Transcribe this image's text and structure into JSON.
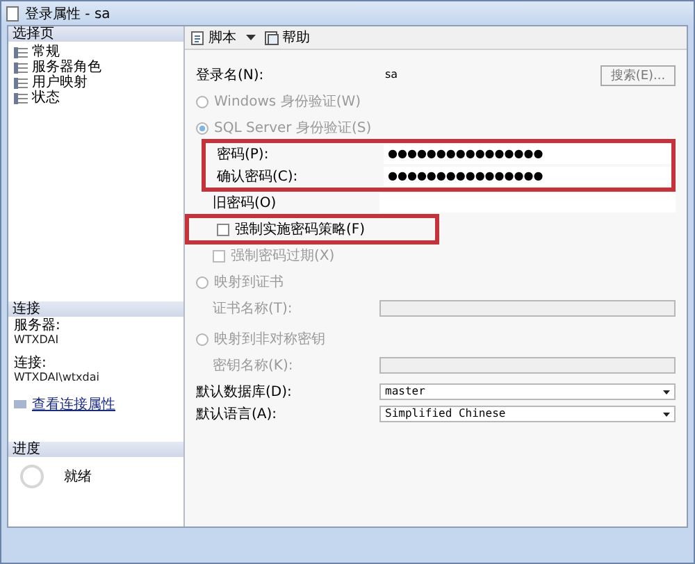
{
  "window": {
    "title": "登录属性 - sa"
  },
  "sidebar": {
    "heading": "选择页",
    "items": [
      {
        "label": "常规"
      },
      {
        "label": "服务器角色"
      },
      {
        "label": "用户映射"
      },
      {
        "label": "状态"
      }
    ]
  },
  "connection": {
    "heading": "连接",
    "server_label": "服务器:",
    "server": "WTXDAI",
    "connection_label": "连接:",
    "connection": "WTXDAI\\wtxdai",
    "link": "查看连接属性"
  },
  "progress": {
    "heading": "进度",
    "status": "就绪"
  },
  "toolbar": [
    {
      "label": "脚本",
      "kind": "dropdown"
    },
    {
      "label": "帮助",
      "kind": "button"
    }
  ],
  "form": {
    "rows": [
      {
        "kind": "text",
        "label": "登录名(N):",
        "value": "sa",
        "button": "搜索(E)..."
      },
      {
        "kind": "radio",
        "label": "Windows 身份验证(W)",
        "selected": false,
        "disabled": true
      },
      {
        "kind": "radio",
        "label": "SQL Server 身份验证(S)",
        "selected": true,
        "disabled": true,
        "children": [
          {
            "kind": "highlight",
            "children": [
              {
                "kind": "password",
                "label": "密码(P):",
                "value": "●●●●●●●●●●●●●●●●"
              },
              {
                "kind": "password",
                "label": "确认密码(C):",
                "value": "●●●●●●●●●●●●●●●●"
              }
            ]
          },
          {
            "kind": "password",
            "label": "旧密码(O)"
          },
          {
            "kind": "highlight",
            "children": [
              {
                "kind": "checkbox",
                "label": "强制实施密码策略(F)",
                "checked": false,
                "disabled": false
              }
            ]
          },
          {
            "kind": "checkbox",
            "label": "强制密码过期(X)",
            "checked": false,
            "disabled": true
          }
        ]
      },
      {
        "kind": "radio",
        "label": "映射到证书",
        "selected": false,
        "disabled": true,
        "children": [
          {
            "kind": "field",
            "label": "证书名称(T):",
            "disabled": true
          }
        ]
      },
      {
        "kind": "radio",
        "label": "映射到非对称密钥",
        "selected": false,
        "disabled": true,
        "children": [
          {
            "kind": "field",
            "label": "密钥名称(K):",
            "disabled": true
          }
        ]
      },
      {
        "kind": "combo",
        "label": "默认数据库(D):",
        "value": "master"
      },
      {
        "kind": "combo",
        "label": "默认语言(A):",
        "value": "Simplified Chinese"
      }
    ]
  }
}
